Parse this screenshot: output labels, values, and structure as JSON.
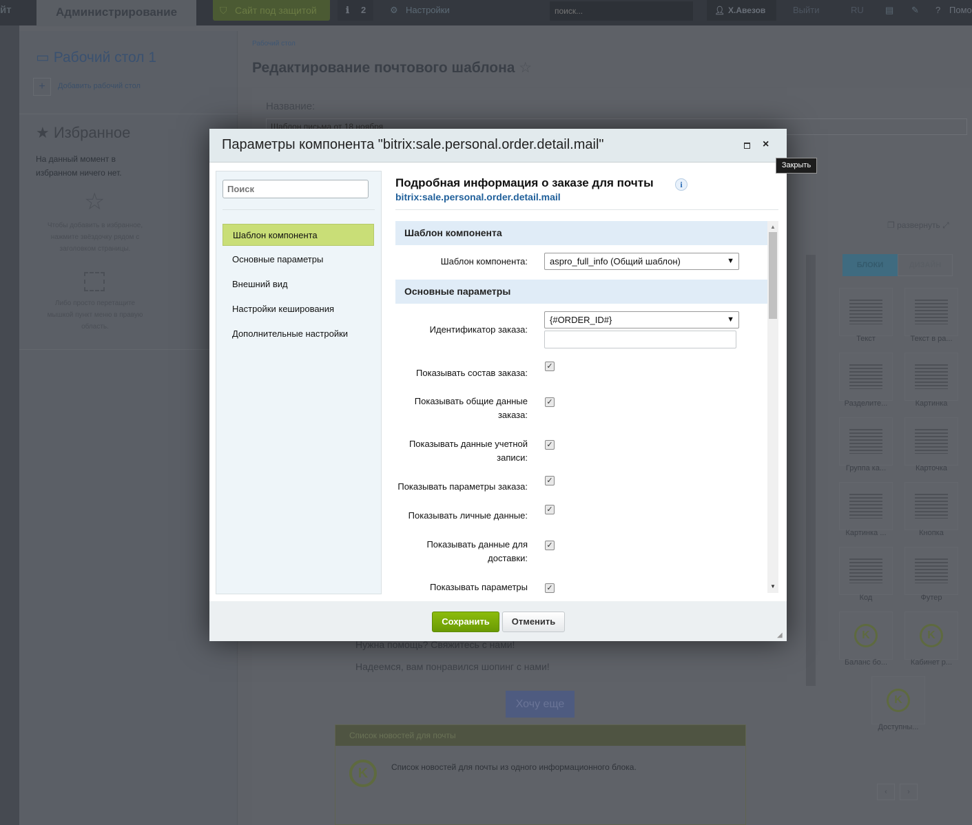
{
  "topbar": {
    "site_fragment": "йт",
    "admin_tab": "Администрирование",
    "secure": "Сайт под защитой",
    "notif_count": "2",
    "settings": "Настройки",
    "search_placeholder": "поиск...",
    "user": "Х.Авезов",
    "logout": "Выйти",
    "lang": "RU",
    "help": "Помо"
  },
  "left_panel": {
    "desktop_title": "Рабочий стол 1",
    "add_desktop": "Добавить рабочий стол",
    "fav_title": "Избранное",
    "fav_empty": "На данный момент в избранном ничего нет.",
    "fav_hint": "Чтобы добавить в избранное, нажмите звёздочку рядом с заголовком страницы.",
    "drag_hint": "Либо просто перетащите мышкой пункт меню в правую область."
  },
  "main": {
    "breadcrumb": "Рабочий стол",
    "page_title": "Редактирование почтового шаблона",
    "name_label": "Название:",
    "name_value": "Шаблон письма от 18 ноября",
    "expand": "развернуть",
    "tabs": [
      "БЛОКИ",
      "ДИЗАЙН"
    ],
    "blocks": [
      "Текст",
      "Текст в ра...",
      "Разделите...",
      "Картинка",
      "Группа ка...",
      "Карточка",
      "Картинка ...",
      "Кнопка",
      "Код",
      "Футер",
      "Баланс бо...",
      "Кабинет р...",
      "Доступны..."
    ],
    "help_text": "Нужна помощь? Свяжитесь с нами!",
    "thanks": "Надеемся, вам понравился шопинг с нами!",
    "more_btn": "Хочу еще",
    "news_block_title": "Список новостей для почты",
    "news_block_desc": "Список новостей для почты из одного информационного блока."
  },
  "modal": {
    "title": "Параметры компонента \"bitrix:sale.personal.order.detail.mail\"",
    "close_tooltip": "Закрыть",
    "search_placeholder": "Поиск",
    "nav": [
      "Шаблон компонента",
      "Основные параметры",
      "Внешний вид",
      "Настройки кеширования",
      "Дополнительные настройки"
    ],
    "component_title": "Подробная информация о заказе для почты",
    "component_id": "bitrix:sale.personal.order.detail.mail",
    "sections": [
      "Шаблон компонента",
      "Основные параметры"
    ],
    "template_label": "Шаблон компонента:",
    "template_value": "aspro_full_info (Общий шаблон)",
    "order_id_label": "Идентификатор заказа:",
    "order_id_value": "{#ORDER_ID#}",
    "checks": [
      {
        "label": "Показывать состав заказа:",
        "checked": true
      },
      {
        "label": "Показывать общие данные заказа:",
        "checked": true
      },
      {
        "label": "Показывать данные учетной записи:",
        "checked": true
      },
      {
        "label": "Показывать параметры заказа:",
        "checked": true
      },
      {
        "label": "Показывать личные данные:",
        "checked": true
      },
      {
        "label": "Показывать данные для доставки:",
        "checked": true
      },
      {
        "label": "Показывать параметры",
        "checked": true
      }
    ],
    "save": "Сохранить",
    "cancel": "Отменить"
  }
}
